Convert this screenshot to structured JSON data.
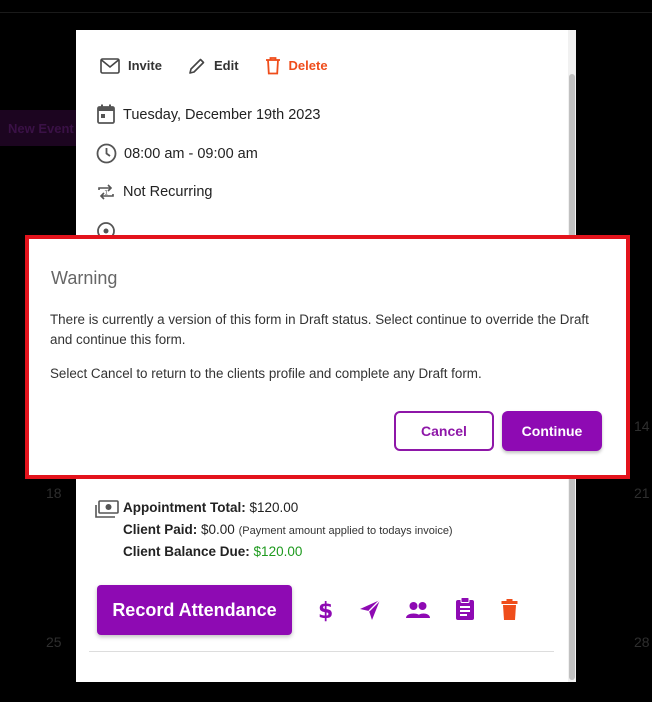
{
  "background": {
    "new_event_chip": "New Event",
    "day_numbers": [
      "18",
      "25",
      "14",
      "21",
      "28"
    ]
  },
  "event": {
    "actions": {
      "invite": "Invite",
      "edit": "Edit",
      "delete": "Delete"
    },
    "date": "Tuesday, December 19th 2023",
    "time": "08:00 am - 09:00 am",
    "recurrence": "Not Recurring"
  },
  "warning": {
    "title": "Warning",
    "message1": "There is currently a version of this form in Draft status. Select continue to override the Draft and continue this form.",
    "message2": "Select Cancel to return to the clients profile and complete any Draft form.",
    "cancel_label": "Cancel",
    "continue_label": "Continue"
  },
  "totals": {
    "appointment_total_label": "Appointment Total:",
    "appointment_total_value": "$120.00",
    "client_paid_label": "Client Paid:",
    "client_paid_value": "$0.00",
    "client_paid_note": "(Payment amount applied to todays invoice)",
    "balance_due_label": "Client Balance Due:",
    "balance_due_value": "$120.00"
  },
  "footer": {
    "record_attendance_label": "Record Attendance",
    "tools": [
      "dollar-icon",
      "send-icon",
      "group-icon",
      "clipboard-icon",
      "trash-icon"
    ]
  },
  "colors": {
    "brand_purple": "#8e0ab3",
    "delete_orange": "#ef4d1b",
    "highlight_red": "#e3131c",
    "balance_green": "#1e9a1e"
  }
}
